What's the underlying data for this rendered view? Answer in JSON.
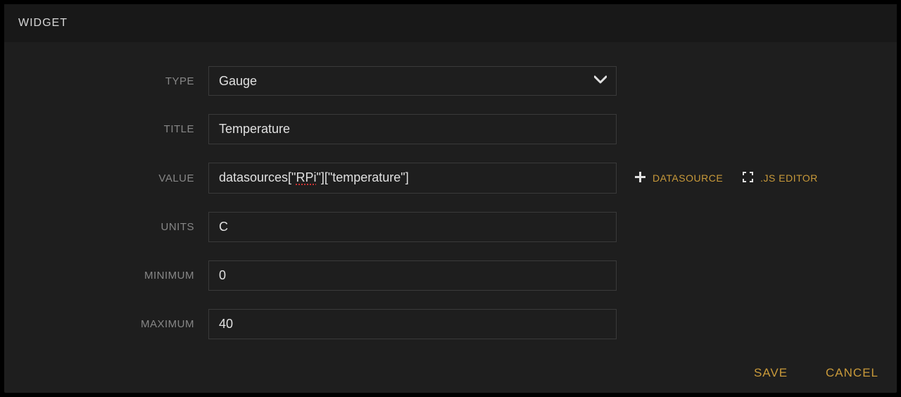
{
  "header": {
    "title": "WIDGET"
  },
  "form": {
    "type": {
      "label": "TYPE",
      "value": "Gauge"
    },
    "title": {
      "label": "TITLE",
      "value": "Temperature"
    },
    "value": {
      "label": "VALUE",
      "prefix": "datasources[\"",
      "spellErr": "RPi",
      "suffix": "\"][\"temperature\"]",
      "datasource_label": "DATASOURCE",
      "jseditor_label": ".JS EDITOR"
    },
    "units": {
      "label": "UNITS",
      "value": "C"
    },
    "minimum": {
      "label": "MINIMUM",
      "value": "0"
    },
    "maximum": {
      "label": "MAXIMUM",
      "value": "40"
    }
  },
  "footer": {
    "save": "SAVE",
    "cancel": "CANCEL"
  }
}
